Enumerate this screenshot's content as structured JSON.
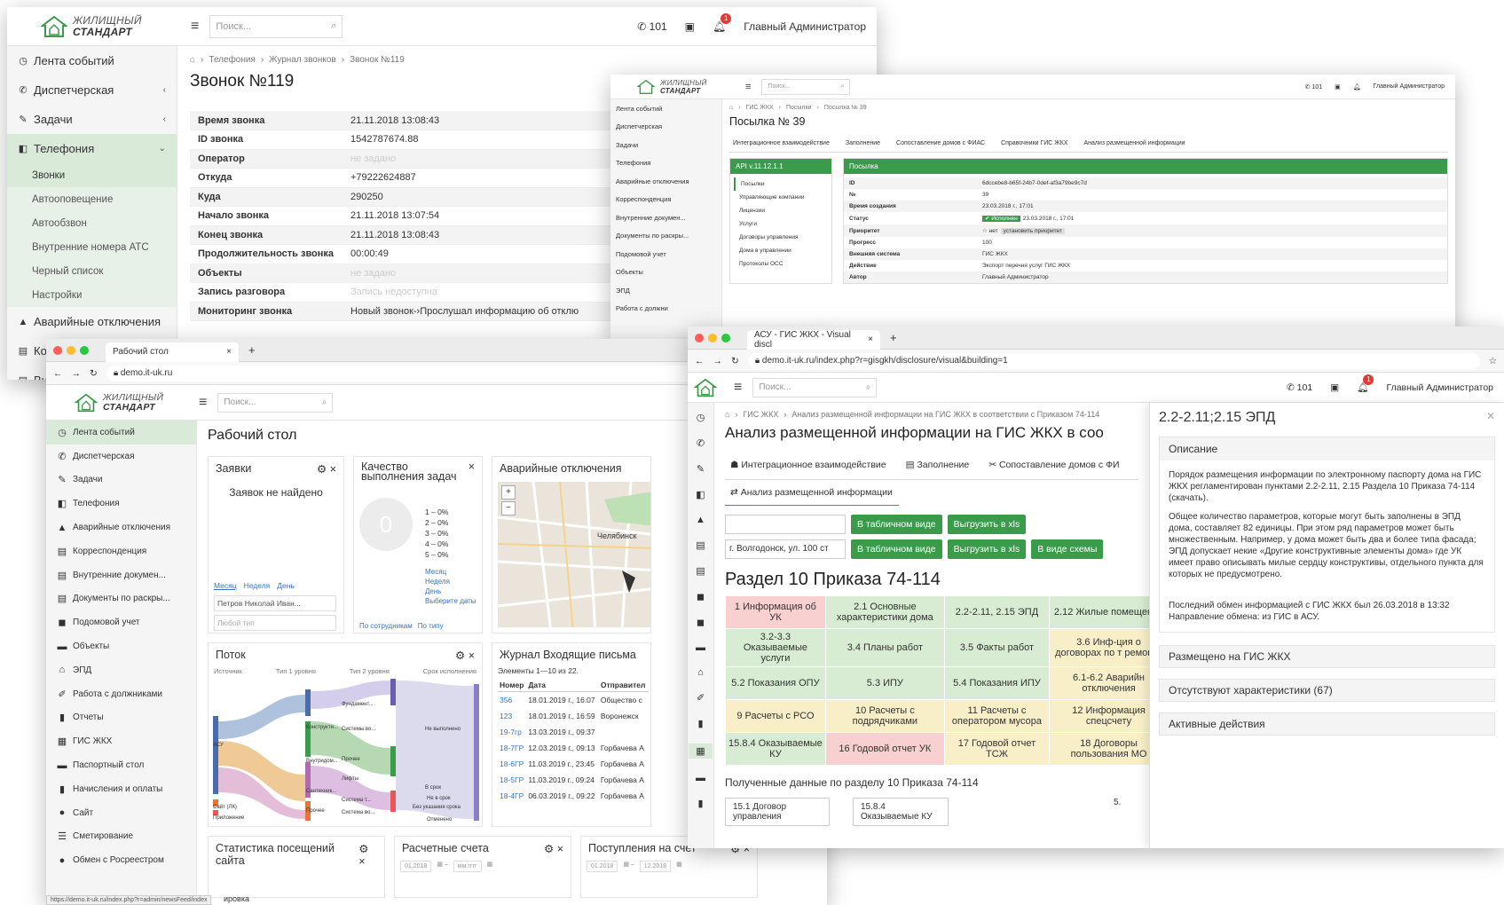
{
  "brand": {
    "line1": "ЖИЛИЩНЫЙ",
    "line2": "СТАНДАРТ"
  },
  "header": {
    "search_placeholder": "Поиск...",
    "phone": "101",
    "user": "Главный Администратор",
    "notif": "1",
    "hamburger": "≡"
  },
  "w1": {
    "sidebar": [
      {
        "icon": "clock-icon",
        "glyph": "◷",
        "label": "Лента событий",
        "chev": ""
      },
      {
        "icon": "phone-icon",
        "glyph": "✆",
        "label": "Диспетчерская",
        "chev": "‹"
      },
      {
        "icon": "edit-icon",
        "glyph": "✎",
        "label": "Задачи",
        "chev": "‹"
      },
      {
        "icon": "phone-box-icon",
        "glyph": "◧",
        "label": "Телефония",
        "chev": "⌄"
      }
    ],
    "submenu": [
      "Звонки",
      "Автооповещение",
      "Автообзвон",
      "Внутренние номера АТС",
      "Черный список",
      "Настройки"
    ],
    "sidebar_after": [
      {
        "icon": "warning-icon",
        "glyph": "▲",
        "label": "Аварийные отключения"
      },
      {
        "icon": "doc-icon",
        "glyph": "▤",
        "label": "Кор"
      },
      {
        "icon": "doc2-icon",
        "glyph": "▤",
        "label": "Вну"
      }
    ],
    "breadcrumb": [
      "Телефония",
      "Журнал звонков",
      "Звонок №119"
    ],
    "title": "Звонок №119",
    "rows": [
      {
        "k": "Время звонка",
        "v": "21.11.2018 13:08:43",
        "m": false
      },
      {
        "k": "ID звонка",
        "v": "1542787674.88",
        "m": false
      },
      {
        "k": "Оператор",
        "v": "не задано",
        "m": true
      },
      {
        "k": "Откуда",
        "v": "+79222624887",
        "m": false
      },
      {
        "k": "Куда",
        "v": "290250",
        "m": false
      },
      {
        "k": "Начало звонка",
        "v": "21.11.2018 13:07:54",
        "m": false
      },
      {
        "k": "Конец звонка",
        "v": "21.11.2018 13:08:43",
        "m": false
      },
      {
        "k": "Продолжительность звонка",
        "v": "00:00:49",
        "m": false
      },
      {
        "k": "Объекты",
        "v": "не задано",
        "m": true
      },
      {
        "k": "Запись разговора",
        "v": "Запись недоступна",
        "m": true
      },
      {
        "k": "Мониторинг звонка",
        "v": "Новый звонок-›Прослушал информацию об отклю",
        "m": false
      }
    ]
  },
  "w2": {
    "sidebar": [
      "Лента событий",
      "Диспетчерская",
      "Задачи",
      "Телефония",
      "Аварийные отключения",
      "Корреспонденция",
      "Внутренние докумен...",
      "Документы по раскры...",
      "Подомовой учет",
      "Объекты",
      "ЭПД",
      "Работа с должни"
    ],
    "breadcrumb": [
      "ГИС ЖКХ",
      "Посылки",
      "Посылка № 39"
    ],
    "title": "Посылка № 39",
    "tabs": [
      "Интеграционное взаимодействие",
      "Заполнение",
      "Сопоставление домов с ФИАС",
      "Справочники ГИС ЖКХ",
      "Анализ размещенной информации"
    ],
    "api_title": "API v.11.12.1.1",
    "api_items": [
      "Посылки",
      "Управляющие компании",
      "Лицензии",
      "Услуги",
      "Договоры управления",
      "Дома в управлении",
      "Протоколы ОСС"
    ],
    "pkg_title": "Посылка",
    "pkg": [
      {
        "k": "ID",
        "v": "6dccebe8-b65f-24b7-0def-af3a79be9c7d"
      },
      {
        "k": "№",
        "v": "39"
      },
      {
        "k": "Время создания",
        "v": "23.03.2018 г., 17:01"
      },
      {
        "k": "Статус",
        "v": "23.03.2018 г., 17:01",
        "badge": "✔ Исполнен"
      },
      {
        "k": "Приоритет",
        "v": "☆ нет",
        "badge2": "установить приоритет"
      },
      {
        "k": "Прогресс",
        "v": "100"
      },
      {
        "k": "Внешняя система",
        "v": "ГИС ЖКХ"
      },
      {
        "k": "Действие",
        "v": "Экспорт перечня услуг ГИС ЖКХ"
      },
      {
        "k": "Автор",
        "v": "Главный Администратор"
      }
    ]
  },
  "w3": {
    "tab_title": "Рабочий стол",
    "url": "demo.it-uk.ru",
    "sidebar": [
      {
        "g": "◷",
        "label": "Лента событий"
      },
      {
        "g": "✆",
        "label": "Диспетчерская"
      },
      {
        "g": "✎",
        "label": "Задачи"
      },
      {
        "g": "◧",
        "label": "Телефония"
      },
      {
        "g": "▲",
        "label": "Аварийные отключения"
      },
      {
        "g": "▤",
        "label": "Корреспонденция"
      },
      {
        "g": "▤",
        "label": "Внутренние докумен..."
      },
      {
        "g": "▤",
        "label": "Документы по раскры..."
      },
      {
        "g": "◼",
        "label": "Подомовой учет"
      },
      {
        "g": "▬",
        "label": "Объекты"
      },
      {
        "g": "⌂",
        "label": "ЭПД"
      },
      {
        "g": "✐",
        "label": "Работа с должниками"
      },
      {
        "g": "▮",
        "label": "Отчеты"
      },
      {
        "g": "▦",
        "label": "ГИС ЖКХ"
      },
      {
        "g": "▬",
        "label": "Паспортный стол"
      },
      {
        "g": "▮",
        "label": "Начисления и оплаты"
      },
      {
        "g": "●",
        "label": "Сайт"
      },
      {
        "g": "☰",
        "label": "Сметирование"
      },
      {
        "g": "●",
        "label": "Обмен с Росреестром"
      }
    ],
    "title": "Рабочий стол",
    "zayavki": {
      "title": "Заявки",
      "empty": "Заявок не найдено",
      "periods": [
        "Месяц",
        "Неделя",
        "День"
      ],
      "who": "Петров Николай Иван...",
      "type": "Любой тип"
    },
    "quality": {
      "title": "Качество выполнения задач",
      "zero": "0",
      "items": [
        "1 – 0%",
        "2 – 0%",
        "3 – 0%",
        "4 – 0%",
        "5 – 0%"
      ],
      "links": [
        "Месяц",
        "Неделя",
        "День",
        "Выберите даты"
      ],
      "tabs": [
        "По сотрудникам",
        "По типу"
      ]
    },
    "outages": {
      "title": "Аварийные отключения",
      "city": "Челябинск"
    },
    "flow": {
      "title": "Поток",
      "cols": [
        "Источник",
        "Тип 1 уровня",
        "Тип 2 уровня",
        "Срок исполнения"
      ],
      "labels": [
        "АСУ",
        "Сайт (ЛК)",
        "Приложение",
        "Конструкти...",
        "Системы во...",
        "Внутридом...",
        "Сантехник...",
        "Прочее",
        "Фундамент...",
        "Прочее",
        "Лифты",
        "Система т...",
        "Система во...",
        "Не выполнено",
        "В срок",
        "Не в срок",
        "Без указания срока",
        "Отменено"
      ]
    },
    "journal": {
      "title": "Журнал Входящие письма",
      "count": "Элементы 1—10 из 22.",
      "headers": [
        "Номер",
        "Дата",
        "Отправител"
      ],
      "rows": [
        [
          "356",
          "18.01.2019 г., 16:07",
          "Общество с"
        ],
        [
          "123",
          "18.01.2019 г., 16:59",
          "Воронежск"
        ],
        [
          "19-7гр",
          "13.03.2019 г., 09:37",
          ""
        ],
        [
          "18-7ГР",
          "12.03.2019 г., 09:13",
          "Горбачева А"
        ],
        [
          "18-6ГР",
          "11.03.2019 г., 23:45",
          "Горбачева А"
        ],
        [
          "18-5ГР",
          "11.03.2019 г., 09:24",
          "Горбачева А"
        ],
        [
          "18-4ГР",
          "06.03.2019 г., 09:22",
          "Горбачева А"
        ]
      ]
    },
    "stats": "Статистика посещений сайта",
    "accounts": "Расчетные счета",
    "income": "Поступления на счет",
    "date1": "01.2018",
    "date2": "мм.гггг",
    "date3": "01.2018",
    "date4": "12.2018",
    "status_url": "https://demo.it-uk.ru/index.php?r=admin/newsFeed/index",
    "partial": "ировка"
  },
  "w4": {
    "tab_title": "АСУ - ГИС ЖКХ - Visual discl",
    "url": "demo.it-uk.ru/index.php?r=gisgkh/disclosure/visual&building=1",
    "breadcrumb": [
      "ГИС ЖКХ",
      "Анализ размещенной информации на ГИС ЖКХ в соответствии с Приказом 74-114"
    ],
    "title": "Анализ размещенной информации на ГИС ЖКХ в соо",
    "tabs": [
      "Интеграционное взаимодействие",
      "Заполнение",
      "Сопоставление домов с ФИ"
    ],
    "tab2": "Анализ размещенной информации",
    "address": "г. Волгодонск, ул. 100 ст",
    "btn_table": "В табличном виде",
    "btn_xls": "Выгрузить в xls",
    "btn_scheme": "В виде схемы",
    "section": "Раздел 10 Приказа 74-114",
    "grid": [
      [
        [
          "1 Информация об УК",
          "r"
        ],
        [
          "2.1 Основные характеристики дома",
          "g"
        ],
        [
          "2.2-2.11, 2.15 ЭПД",
          "g"
        ],
        [
          "2.12 Жилые помещения",
          "g"
        ]
      ],
      [
        [
          "3.2-3.3 Оказываемые услуги",
          "g"
        ],
        [
          "3.4 Планы работ",
          "g"
        ],
        [
          "3.5 Факты работ",
          "g"
        ],
        [
          "3.6 Инф-ция о договорах по т ремонту",
          "y"
        ]
      ],
      [
        [
          "5.2 Показания ОПУ",
          "g"
        ],
        [
          "5.3 ИПУ",
          "g"
        ],
        [
          "5.4 Показания ИПУ",
          "g"
        ],
        [
          "6.1-6.2 Аварийн отключения",
          "y"
        ]
      ],
      [
        [
          "9 Расчеты с РСО",
          "y"
        ],
        [
          "10 Расчеты с подрядчиками",
          "y"
        ],
        [
          "11 Расчеты с оператором мусора",
          "y"
        ],
        [
          "12 Информация спецсчету",
          "y"
        ]
      ],
      [
        [
          "15.8.4 Оказываемые КУ",
          "g"
        ],
        [
          "16 Годовой отчет УК",
          "r"
        ],
        [
          "17 Годовой отчет ТСЖ",
          "y"
        ],
        [
          "18 Договоры пользования МО",
          "y"
        ]
      ]
    ],
    "received": "Полученные данные по разделу 10 Приказа 74-114",
    "flow_boxes": [
      "15.1 Договор управления",
      "15.8.4 Оказываемые КУ",
      "5."
    ],
    "side_title": "2.2-2.11;2.15 ЭПД",
    "desc_title": "Описание",
    "desc1": "Порядок размещения информации по электронному паспорту дома на ГИС ЖКХ регламентирован пунктами 2.2-2.11, 2.15 Раздела 10 Приказа 74-114 (скачать).",
    "desc2": "Общее количество параметров, которые могут быть заполнены в ЭПД дома, составляет 82 единицы. При этом ряд параметров может быть множественным. Например, у дома может быть два и более типа фасада; ЭПД допускает некие «Другие конструктивные элементы дома» где УК имеет право описывать милые сердцу конструктивы, отдельного пункта для которых не предусмотрено.",
    "desc3": "Последний обмен информацией с ГИС ЖКХ был 26.03.2018 в 13:32",
    "desc4": "Направление обмена: из ГИС в АСУ.",
    "acc": [
      "Размещено на ГИС ЖКХ",
      "Отсутствуют характеристики (67)",
      "Активные действия"
    ]
  },
  "colors": {
    "green": "#3a9c4a",
    "red": "#f8d0d0",
    "lightgreen": "#d7ecd2",
    "yellow": "#f8efc8"
  }
}
